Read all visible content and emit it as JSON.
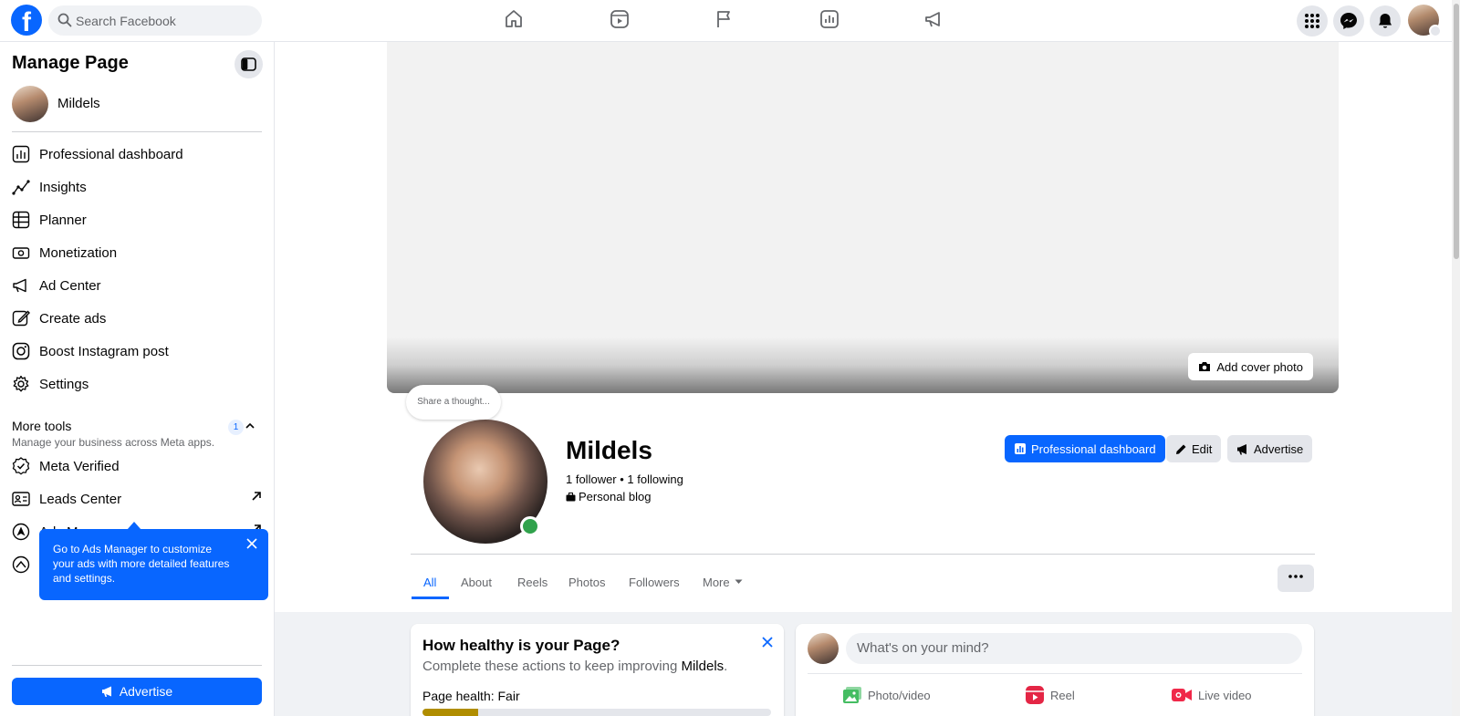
{
  "topbar": {
    "logo": "f",
    "search_placeholder": "Search Facebook",
    "nav_icons": [
      "home-icon",
      "video-icon",
      "flag-icon",
      "chart-icon",
      "megaphone-icon"
    ],
    "right_icons": [
      "menu-grid-icon",
      "messenger-icon",
      "bell-icon"
    ]
  },
  "sidebar": {
    "title": "Manage Page",
    "page_name": "Mildels",
    "items": [
      {
        "label": "Professional dashboard",
        "icon": "dashboard-icon"
      },
      {
        "label": "Insights",
        "icon": "insights-icon"
      },
      {
        "label": "Planner",
        "icon": "planner-icon"
      },
      {
        "label": "Monetization",
        "icon": "monetization-icon"
      },
      {
        "label": "Ad Center",
        "icon": "megaphone-icon"
      },
      {
        "label": "Create ads",
        "icon": "pencil-icon"
      },
      {
        "label": "Boost Instagram post",
        "icon": "instagram-icon"
      },
      {
        "label": "Settings",
        "icon": "gear-icon"
      }
    ],
    "more_tools": {
      "title": "More tools",
      "subtitle": "Manage your business across Meta apps.",
      "badge": "1"
    },
    "tool_items": [
      {
        "label": "Meta Verified",
        "icon": "verified-icon"
      },
      {
        "label": "Leads Center",
        "icon": "leads-icon"
      },
      {
        "label": "Ads Manager",
        "icon": "ads-manager-icon"
      }
    ],
    "tooltip_text": "Go to Ads Manager to customize your ads with more detailed features and settings.",
    "advertise_label": "Advertise"
  },
  "profile": {
    "add_cover_label": "Add cover photo",
    "thought_placeholder": "Share a thought...",
    "name": "Mildels",
    "stats": "1 follower • 1 following",
    "category": "Personal blog",
    "buttons": {
      "dashboard": "Professional dashboard",
      "edit": "Edit",
      "advertise": "Advertise"
    },
    "tabs": [
      "All",
      "About",
      "Reels",
      "Photos",
      "Followers",
      "More"
    ],
    "active_tab": "All"
  },
  "health": {
    "title": "How healthy is your Page?",
    "subtitle_prefix": "Complete these actions to keep improving ",
    "subtitle_page": "Mildels",
    "subtitle_suffix": ".",
    "label": "Page health: Fair",
    "progress_fraction": 0.16,
    "color": "#b08d00"
  },
  "composer": {
    "placeholder": "What's on your mind?",
    "actions": [
      "Photo/video",
      "Reel",
      "Live video"
    ]
  },
  "colors": {
    "brand": "#0866ff",
    "online": "#31a24c",
    "photo_green": "#45bd62",
    "reel_pink": "#e42645",
    "live_red": "#f02849"
  }
}
